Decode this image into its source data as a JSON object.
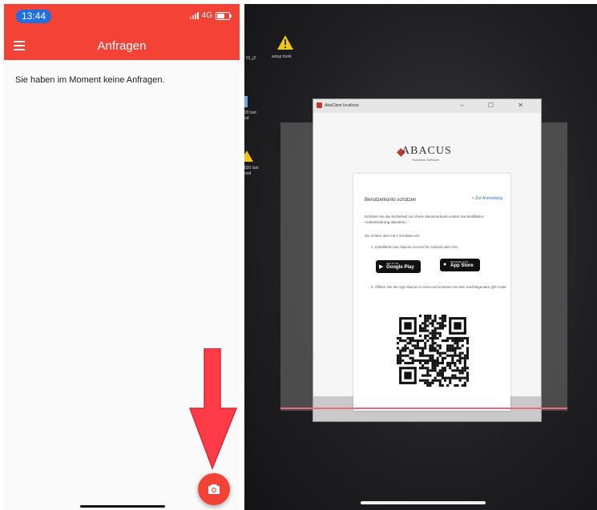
{
  "left_screen": {
    "status": {
      "time": "13:44",
      "network": "4G"
    },
    "appbar": {
      "title": "Anfragen",
      "menu_icon": "hamburger-menu-icon"
    },
    "empty_message": "Sie haben im Moment keine Anfragen.",
    "fab": {
      "icon": "camera-icon"
    },
    "annotation": {
      "icon": "down-arrow-icon",
      "color": "#ff3b47"
    },
    "colors": {
      "primary": "#f44336"
    }
  },
  "right_screen": {
    "desktop": {
      "labels": [
        "01_j2",
        "setup trunk",
        "20 last",
        "od",
        "020 last",
        "ood"
      ]
    },
    "window": {
      "title": "AbaClient localhost",
      "controls": "– ☐ ✕",
      "logo": "ABACUS",
      "logo_sub": "Business Software",
      "card": {
        "title": "Benutzerkonto schützen",
        "back_link": "« Zur Anmeldung",
        "intro": "Erhöhen Sie die Sicherheit von Ihrem Benutzerkonto indem Sie Multifaktor-Authentisierung aktivieren.",
        "steps_intro": "Sie richten dies mit 2 Schritten ein:",
        "step1": "1. Installieren Sie Abacus Access für Android oder iOS.",
        "google_play": {
          "small": "GET IT ON",
          "big": "Google Play"
        },
        "app_store": {
          "small": "Download on the",
          "big": "App Store"
        },
        "step2": "2. Öffnen Sie die App Abacus Access und scannen Sie den nachfolgenden QR-Code."
      }
    },
    "scan_line_color": "#e96b7a"
  }
}
